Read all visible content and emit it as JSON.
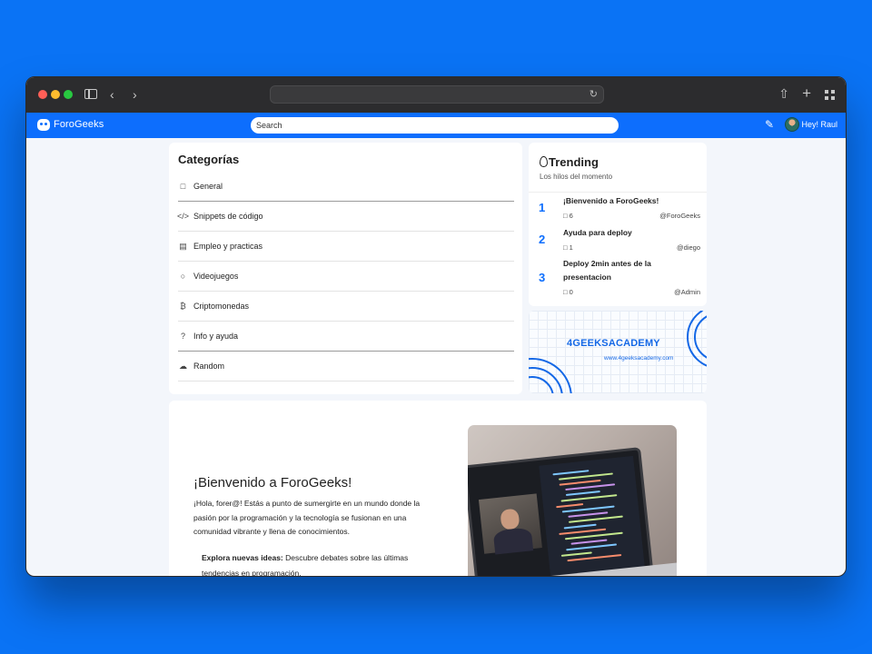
{
  "browser": {
    "url": "",
    "icons": [
      "sidebar-icon",
      "back-icon",
      "forward-icon",
      "reload-icon",
      "share-icon",
      "new-tab-icon",
      "tab-overview-icon"
    ]
  },
  "appbar": {
    "brand": "ForoGeeks",
    "search_placeholder": "Search",
    "greeting": "Hey! Raul",
    "accent_color": "#0d6efd"
  },
  "categories": {
    "title": "Categorías",
    "items": [
      {
        "label": "General",
        "icon": "chat-icon"
      },
      {
        "label": "Snippets de código",
        "icon": "code-icon"
      },
      {
        "label": "Empleo y practicas",
        "icon": "document-icon"
      },
      {
        "label": "Videojuegos",
        "icon": "gamepad-icon"
      },
      {
        "label": "Criptomonedas",
        "icon": "bitcoin-icon"
      },
      {
        "label": "Info y ayuda",
        "icon": "help-icon"
      },
      {
        "label": "Random",
        "icon": "cloud-icon"
      }
    ]
  },
  "trending": {
    "title": "Trending",
    "subtitle": "Los hilos del momento",
    "threads": [
      {
        "rank": "1",
        "title": "¡Bienvenido a ForoGeeks!",
        "replies": "6",
        "user": "@ForoGeeks"
      },
      {
        "rank": "2",
        "title": "Ayuda para deploy",
        "replies": "1",
        "user": "@diego"
      },
      {
        "rank": "3",
        "title": "Deploy 2min antes de la presentacion",
        "replies": "0",
        "user": "@Admin"
      }
    ]
  },
  "ad": {
    "title": "4GEEKSACADEMY",
    "url": "www.4geeksacademy.com"
  },
  "welcome": {
    "title": "¡Bienvenido a ForoGeeks!",
    "body": "¡Hola, forer@! Estás a punto de sumergirte en un mundo donde la pasión por la programación y la tecnología se fusionan en una comunidad vibrante y llena de conocimientos.",
    "explore_label": "Explora nuevas ideas:",
    "explore_text": " Descubre debates sobre las últimas tendencias en programación."
  }
}
